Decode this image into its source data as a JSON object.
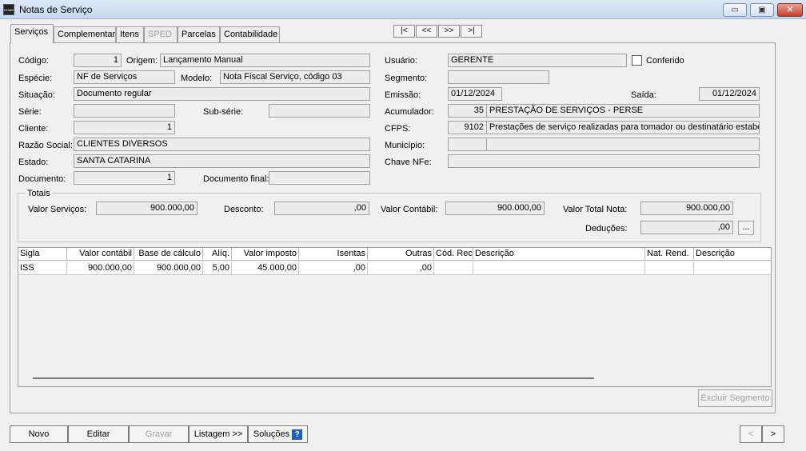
{
  "window": {
    "app_icon_text": "DOMINIO",
    "title": "Notas de Serviço",
    "minimize": "▭",
    "maximize": "▣",
    "close": "✕"
  },
  "tabs": [
    {
      "label": "Serviços",
      "state": "active"
    },
    {
      "label": "Complementar",
      "state": "normal"
    },
    {
      "label": "Itens",
      "state": "normal"
    },
    {
      "label": "SPED",
      "state": "disabled"
    },
    {
      "label": "Parcelas",
      "state": "normal"
    },
    {
      "label": "Contabilidade",
      "state": "normal"
    }
  ],
  "nav": {
    "first": "|<",
    "prev": "<<",
    "next": ">>",
    "last": ">|"
  },
  "form": {
    "codigo": {
      "label": "Código:",
      "value": "1"
    },
    "origem": {
      "label": "Origem:",
      "value": "Lançamento Manual"
    },
    "especie": {
      "label": "Espécie:",
      "value": "NF de Serviços"
    },
    "modelo": {
      "label": "Modelo:",
      "value": "Nota Fiscal Serviço, código 03"
    },
    "situacao": {
      "label": "Situação:",
      "value": "Documento regular"
    },
    "serie": {
      "label": "Série:",
      "value": ""
    },
    "subserie": {
      "label": "Sub-série:",
      "value": ""
    },
    "cliente": {
      "label": "Cliente:",
      "value": "1"
    },
    "razao_social": {
      "label": "Razão Social:",
      "value": "CLIENTES DIVERSOS"
    },
    "estado": {
      "label": "Estado:",
      "value": "SANTA CATARINA"
    },
    "documento": {
      "label": "Documento:",
      "value": "1"
    },
    "documento_final": {
      "label": "Documento final:",
      "value": ""
    },
    "usuario": {
      "label": "Usuário:",
      "value": "GERENTE"
    },
    "conferido": {
      "label": "Conferido",
      "checked": false
    },
    "segmento": {
      "label": "Segmento:",
      "value": ""
    },
    "emissao": {
      "label": "Emissão:",
      "value": "01/12/2024"
    },
    "saida": {
      "label": "Saída:",
      "value": "01/12/2024"
    },
    "acumulador": {
      "label": "Acumulador:",
      "code": "35",
      "desc": "PRESTAÇÃO DE SERVIÇOS - PERSE"
    },
    "cfps": {
      "label": "CFPS:",
      "code": "9102",
      "desc": "Prestações de serviço realizadas para tomador ou destinatário estabelec"
    },
    "municipio": {
      "label": "Município:",
      "code": "",
      "desc": ""
    },
    "chave_nfe": {
      "label": "Chave NFe:",
      "value": ""
    }
  },
  "totais": {
    "legend": "Totais",
    "valor_servicos": {
      "label": "Valor Serviços:",
      "value": "900.000,00"
    },
    "desconto": {
      "label": "Desconto:",
      "value": ",00"
    },
    "valor_contabil": {
      "label": "Valor Contábil:",
      "value": "900.000,00"
    },
    "valor_total_nota": {
      "label": "Valor Total Nota:",
      "value": "900.000,00"
    },
    "deducoes": {
      "label": "Deduções:",
      "value": ",00",
      "button": "..."
    }
  },
  "grid": {
    "headers": [
      "Sigla",
      "Valor contábil",
      "Base de cálculo",
      "Alíq.",
      "Valor imposto",
      "Isentas",
      "Outras",
      "Cód. Rec.",
      "Descrição",
      "Nat. Rend.",
      "Descrição"
    ],
    "rows": [
      [
        "ISS",
        "900.000,00",
        "900.000,00",
        "5,00",
        "45.000,00",
        ",00",
        ",00",
        "",
        "",
        "",
        ""
      ]
    ]
  },
  "excluir_segmento": "Excluir Segmento",
  "bottom": {
    "novo": "Novo",
    "editar": "Editar",
    "gravar": "Gravar",
    "listagem": "Listagem >>",
    "solucoes": "Soluções",
    "help": "?",
    "prev": "<",
    "next": ">"
  }
}
